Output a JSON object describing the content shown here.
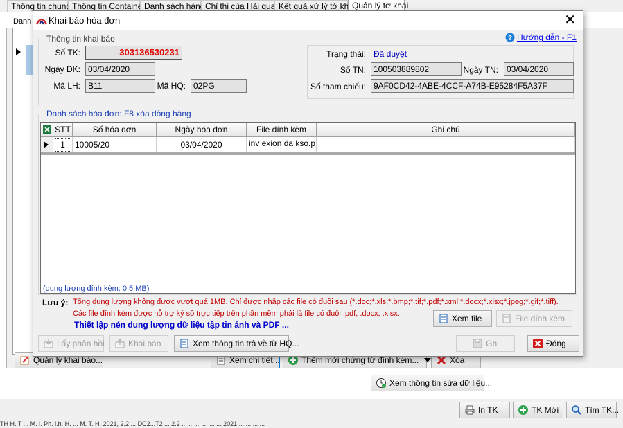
{
  "tabs": [
    "Thông tin chung",
    "Thông tin Container",
    "Danh sách hàng",
    "Chỉ thị của Hải quan",
    "Kết quả xử lý tờ khai",
    "Quản lý tờ khai"
  ],
  "background": {
    "grid_header": "Danh",
    "btn_quan_ly": "Quản lý khai báo...",
    "btn_xem_chi_tiet": "Xem chi tiết...",
    "btn_them_moi": "Thêm mới chứng từ đính kèm...",
    "btn_xoa": "Xóa",
    "btn_xem_sua": "Xem thông tin sửa dữ liệu...",
    "btn_in_tk": "In TK",
    "btn_tk_moi": "TK Mới",
    "btn_tim_tk": "Tìm TK...",
    "status_text": "TH H. T ... M. l. Ph. l.h. H. ... M. T. H.   2021, 2.2 ... DC2...T2 ... 2.2 ...   ... ... ... ... ... 2021 ... ... ... ..."
  },
  "dialog": {
    "title": "Khai báo hóa đơn",
    "help_link": "Hướng dẫn - F1",
    "info_group": "Thông tin khai báo",
    "so_tk_label": "Số TK:",
    "so_tk": "303136530231",
    "ngay_dk_label": "Ngày ĐK:",
    "ngay_dk": "03/04/2020",
    "ma_lh_label": "Mã LH:",
    "ma_lh": "B11",
    "ma_hq_label": "Mã HQ:",
    "ma_hq": "02PG",
    "trang_thai_label": "Trạng thái:",
    "trang_thai": "Đã duyệt",
    "so_tn_label": "Số TN:",
    "so_tn": "100503889802",
    "ngay_tn_label": "Ngày TN:",
    "ngay_tn": "03/04/2020",
    "so_tham_chieu_label": "Số tham chiếu:",
    "so_tham_chieu": "9AF0CD42-4ABE-4CCF-A74B-E95284F5A37F",
    "list_group": "Danh sách hóa đơn: F8 xóa dòng hàng",
    "columns": [
      "STT",
      "Số hóa đơn",
      "Ngày hóa đơn",
      "File đính kèm",
      "Ghi chú"
    ],
    "rows": [
      {
        "stt": "1",
        "so_hoa_don": "10005/20",
        "ngay": "03/04/2020",
        "file": "inv exion da kso.p",
        "ghi_chu": ""
      }
    ],
    "capacity": "(dung lượng đính kèm: 0.5 MB)",
    "note_label": "Lưu ý:",
    "note_1": "Tổng dung lượng không được vượt quá 1MB. Chỉ được nhập các file có đuôi sau (*.doc;*.xls;*.bmp;*.tif;*.pdf;*.xml;*.docx;*.xlsx;*.jpeg;*.gif;*.tiff).",
    "note_2": "Các file đính kèm được hỗ trợ ký số trực tiếp trên phần mềm phải là file có đuôi .pdf, .docx, .xlsx.",
    "compress_link": "Thiết lập nén dung lượng dữ liệu tập tin ảnh và PDF ...",
    "btn_xem_file": "Xem file",
    "btn_file_dinh_kem": "File đính kèm",
    "btn_lay_phan_hoi": "Lấy phản hồi",
    "btn_khai_bao": "Khai báo",
    "btn_xem_tt": "Xem thông tin trả về từ HQ...",
    "btn_ghi": "Ghi",
    "btn_dong": "Đóng"
  },
  "colors": {
    "so_tk_red": "#e00000",
    "status_blue": "#0000c0",
    "note_red": "#c00000",
    "link_blue": "#0000cc"
  }
}
